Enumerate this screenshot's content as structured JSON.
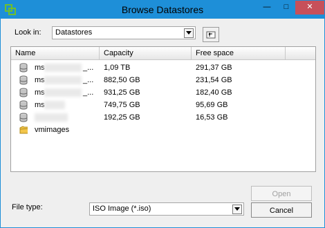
{
  "window": {
    "title": "Browse Datastores"
  },
  "titlebar": {
    "minimize": "—",
    "maximize": "□",
    "close": "✕"
  },
  "look_in": {
    "label": "Look in:",
    "value": "Datastores"
  },
  "columns": [
    "Name",
    "Capacity",
    "Free space"
  ],
  "rows": [
    {
      "icon": "database-icon",
      "name": "ms",
      "suffix": "_...",
      "capacity": "1,09 TB",
      "free": "291,37 GB"
    },
    {
      "icon": "database-icon",
      "name": "ms",
      "suffix": "_...",
      "capacity": "882,50 GB",
      "free": "231,54 GB"
    },
    {
      "icon": "database-icon",
      "name": "ms",
      "suffix": "_...",
      "capacity": "931,25 GB",
      "free": "182,40 GB"
    },
    {
      "icon": "database-icon",
      "name": "ms",
      "suffix": "",
      "capacity": "749,75 GB",
      "free": "95,69 GB"
    },
    {
      "icon": "database-icon",
      "name": "",
      "suffix": "",
      "capacity": "192,25 GB",
      "free": "16,53 GB"
    },
    {
      "icon": "folder-icon",
      "name": "vmimages",
      "suffix": "",
      "capacity": "",
      "free": ""
    }
  ],
  "file_type": {
    "label": "File type:",
    "value": "ISO Image (*.iso)"
  },
  "buttons": {
    "open": "Open",
    "cancel": "Cancel"
  },
  "colors": {
    "titlebar": "#1e8fd8",
    "close": "#c7505a"
  }
}
